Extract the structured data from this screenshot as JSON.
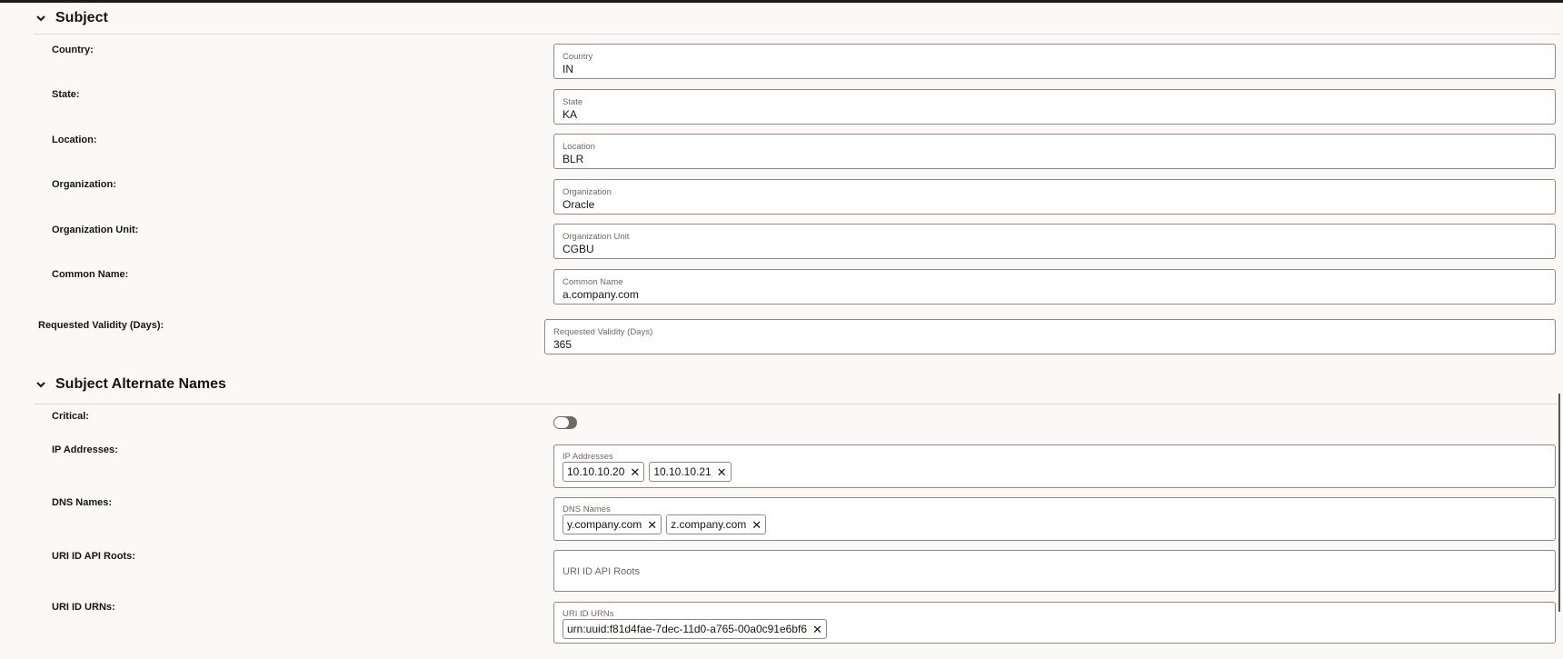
{
  "sections": {
    "subject": {
      "title": "Subject"
    },
    "san": {
      "title": "Subject Alternate Names"
    }
  },
  "subject_fields": {
    "country": {
      "row_label": "Country:",
      "field_label": "Country",
      "value": "IN"
    },
    "state": {
      "row_label": "State:",
      "field_label": "State",
      "value": "KA"
    },
    "location": {
      "row_label": "Location:",
      "field_label": "Location",
      "value": "BLR"
    },
    "organization": {
      "row_label": "Organization:",
      "field_label": "Organization",
      "value": "Oracle"
    },
    "org_unit": {
      "row_label": "Organization Unit:",
      "field_label": "Organization Unit",
      "value": "CGBU"
    },
    "common_name": {
      "row_label": "Common Name:",
      "field_label": "Common Name",
      "value": "a.company.com"
    }
  },
  "validity": {
    "row_label": "Requested Validity (Days):",
    "field_label": "Requested Validity (Days)",
    "value": "365"
  },
  "san_fields": {
    "critical": {
      "row_label": "Critical:",
      "checked": false
    },
    "ip_addresses": {
      "row_label": "IP Addresses:",
      "field_label": "IP Addresses",
      "chips": [
        "10.10.10.20",
        "10.10.10.21"
      ]
    },
    "dns_names": {
      "row_label": "DNS Names:",
      "field_label": "DNS Names",
      "chips": [
        "y.company.com",
        "z.company.com"
      ]
    },
    "uri_api_roots": {
      "row_label": "URI ID API Roots:",
      "placeholder": "URI ID API Roots"
    },
    "uri_urns": {
      "row_label": "URI ID URNs:",
      "field_label": "URI ID URNs",
      "chips": [
        "urn:uuid:f81d4fae-7dec-11d0-a765-00a0c91e6bf6"
      ]
    }
  },
  "icons": {
    "chevron": "chevron-down-icon",
    "chip_remove": "close-icon"
  },
  "colors": {
    "background": "#faf9f8",
    "border": "#8f8a85",
    "toggle_off": "#6f6964"
  }
}
